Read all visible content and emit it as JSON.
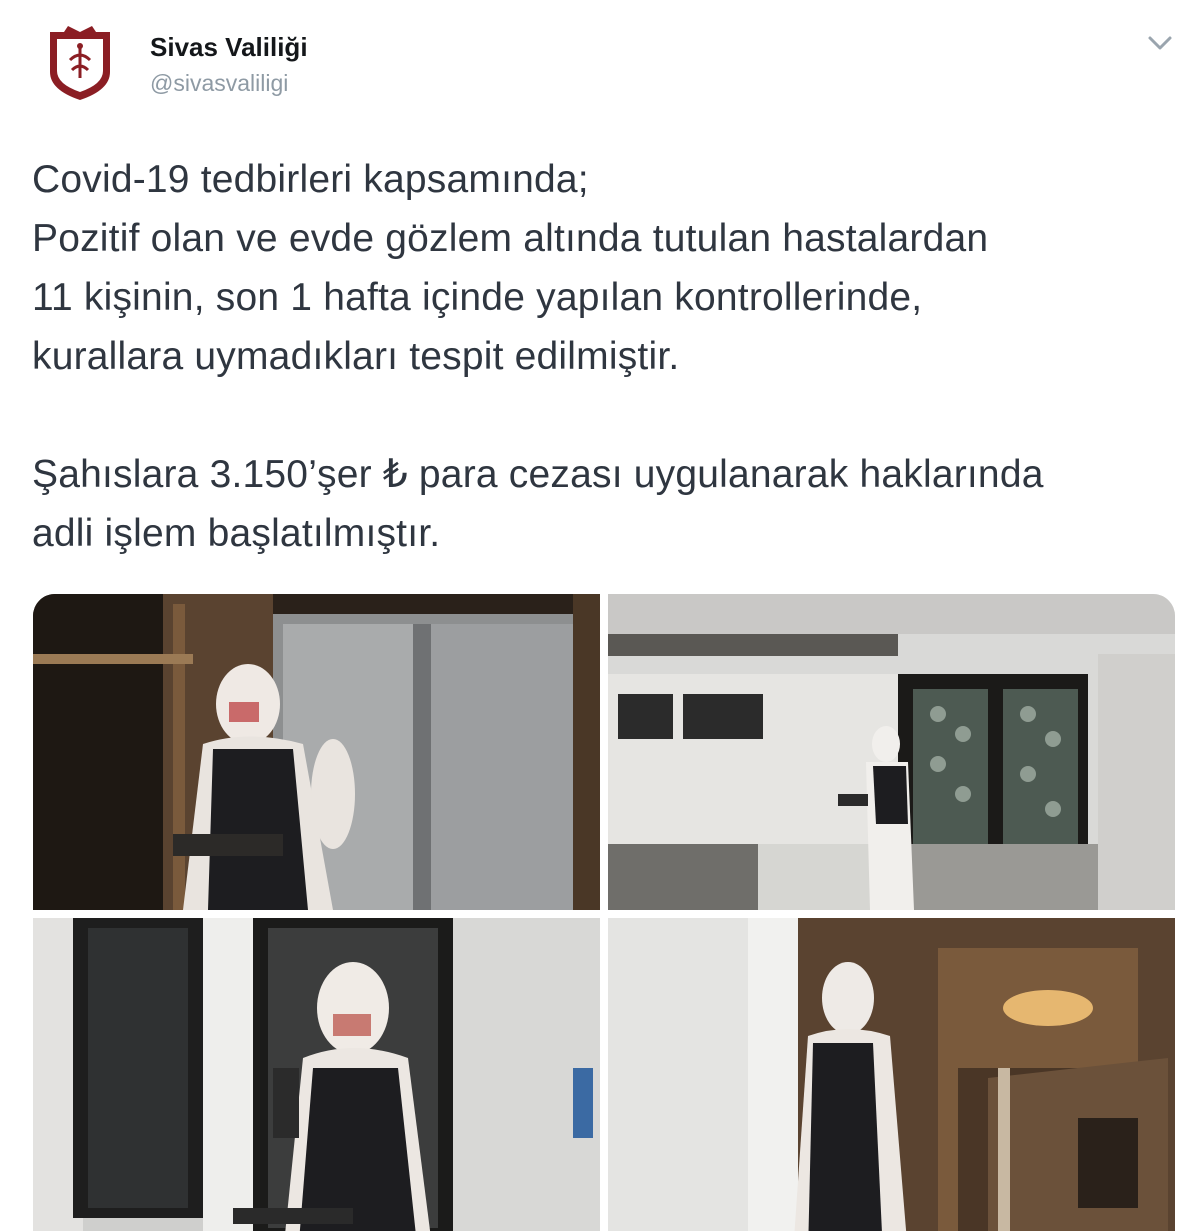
{
  "account": {
    "name": "Sivas Valiliği",
    "handle": "@sivasvaliligi",
    "avatar_icon": "sivas-valiligi-logo-icon",
    "brand_color": "#8b1e24"
  },
  "tweet": {
    "lines": [
      "Covid-19 tedbirleri kapsamında;",
      "Pozitif olan ve evde gözlem altında tutulan hastalardan",
      "11 kişinin, son 1 hafta içinde yapılan kontrollerinde,",
      "kurallara uymadıkları tespit edilmiştir."
    ],
    "lines2": [
      "Şahıslara 3.150’şer ₺ para cezası uygulanarak haklarında",
      "adli işlem başlatılmıştır."
    ]
  },
  "menu": {
    "icon": "chevron-down-icon"
  },
  "media": {
    "photo_count": 4
  }
}
